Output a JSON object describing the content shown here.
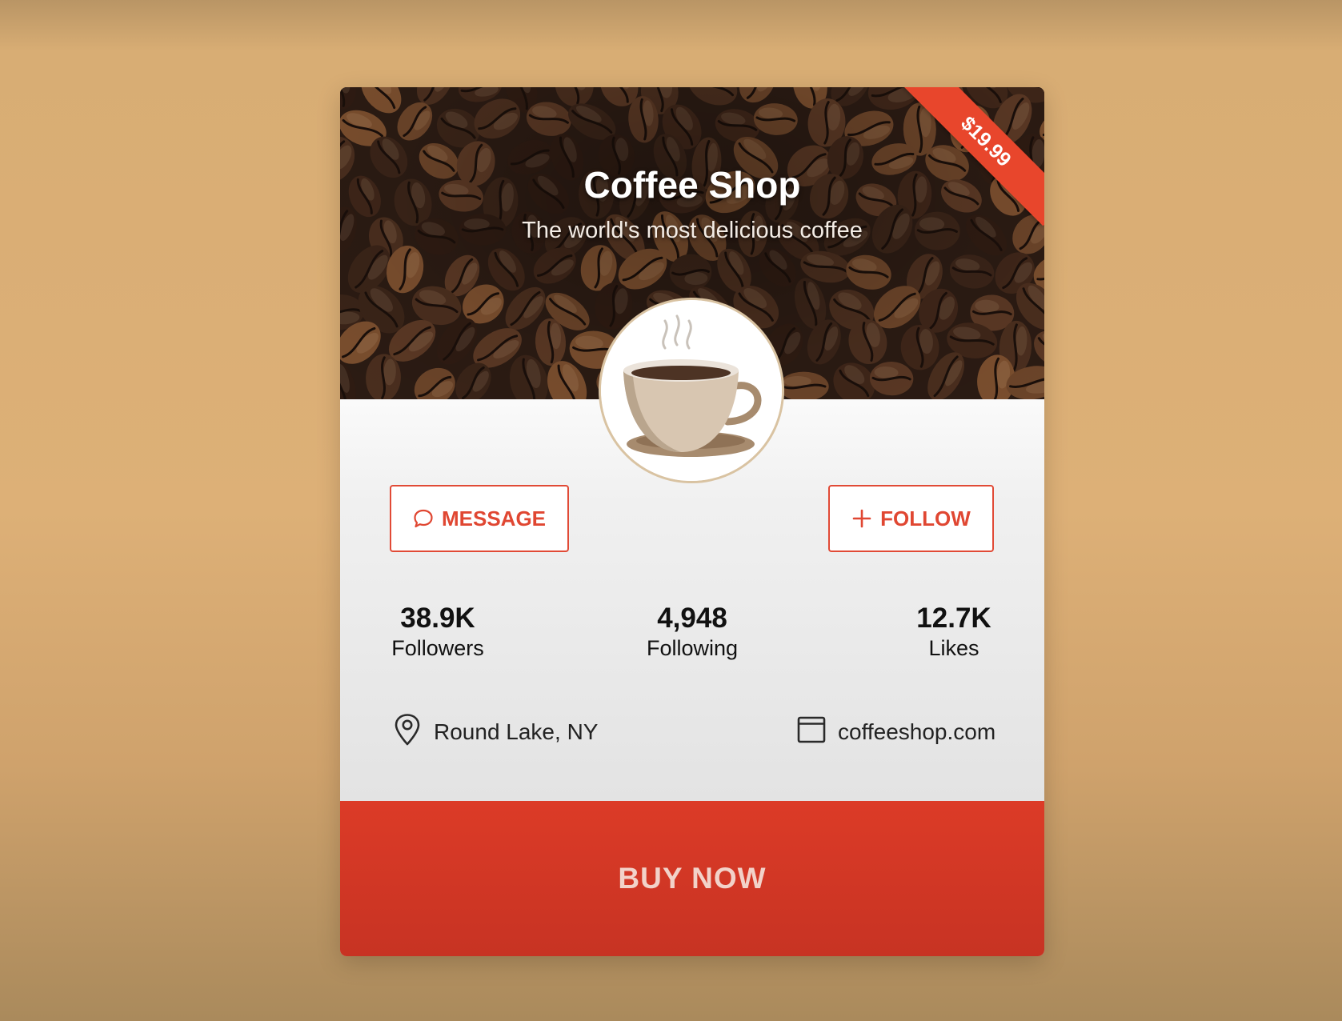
{
  "header": {
    "title": "Coffee Shop",
    "subtitle": "The world's most delicious coffee",
    "price_ribbon": "$19.99"
  },
  "actions": {
    "message_label": "MESSAGE",
    "follow_label": "FOLLOW",
    "buy_label": "BUY NOW"
  },
  "stats": [
    {
      "value": "38.9K",
      "label": "Followers"
    },
    {
      "value": "4,948",
      "label": "Following"
    },
    {
      "value": "12.7K",
      "label": "Likes"
    }
  ],
  "info": {
    "location": "Round Lake, NY",
    "website": "coffeeshop.com"
  },
  "icons": {
    "message": "chat-bubble-icon",
    "follow": "plus-icon",
    "location": "map-pin-icon",
    "website": "browser-window-icon",
    "avatar": "coffee-cup-icon"
  },
  "colors": {
    "accent": "#e14a36",
    "buy_button": "#d23725",
    "background": "#ddb077",
    "ribbon": "#e8462c"
  }
}
